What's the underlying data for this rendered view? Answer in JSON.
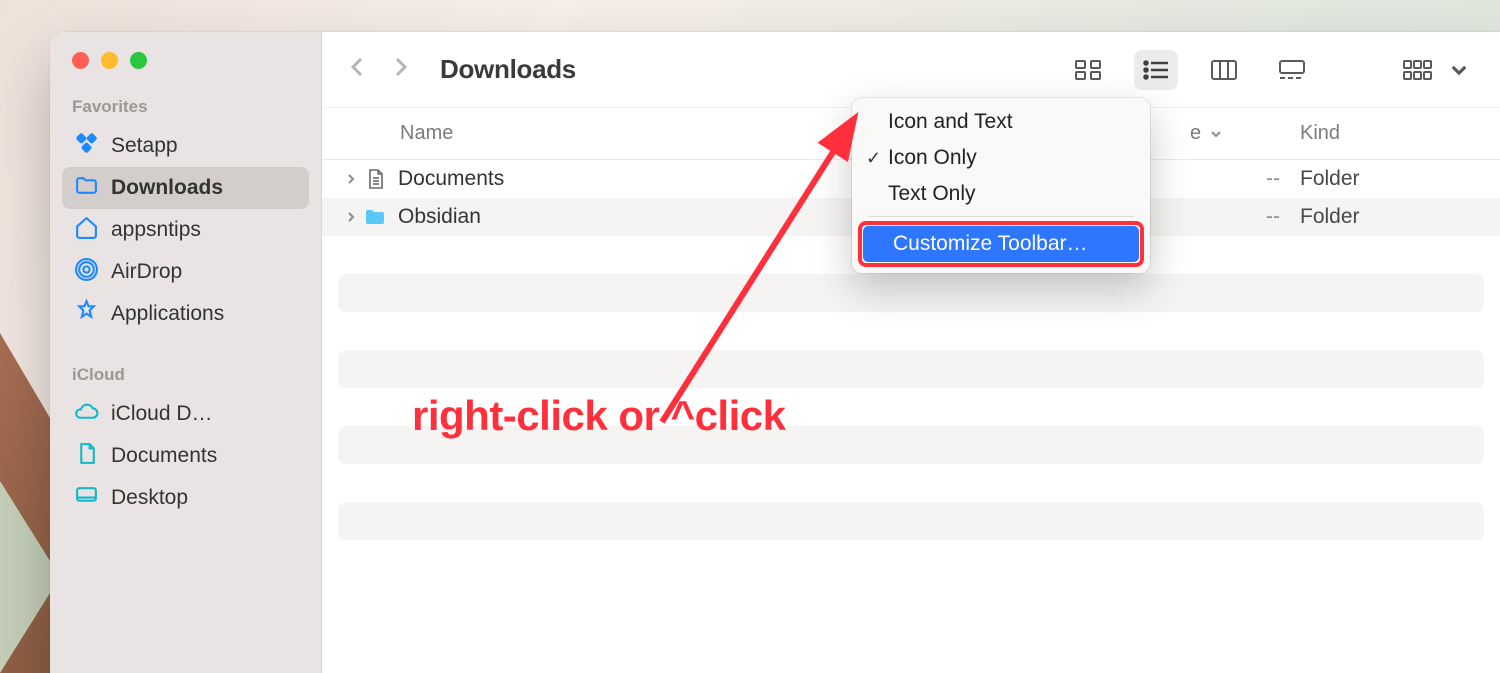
{
  "toolbar": {
    "title": "Downloads"
  },
  "sidebar": {
    "favorites_label": "Favorites",
    "icloud_label": "iCloud",
    "favorites": [
      {
        "label": "Setapp"
      },
      {
        "label": "Downloads"
      },
      {
        "label": "appsntips"
      },
      {
        "label": "AirDrop"
      },
      {
        "label": "Applications"
      }
    ],
    "icloud": [
      {
        "label": "iCloud D…"
      },
      {
        "label": "Documents"
      },
      {
        "label": "Desktop"
      }
    ]
  },
  "columns": {
    "name": "Name",
    "size_suffix": "e",
    "kind": "Kind"
  },
  "rows": [
    {
      "name": "Documents",
      "size": "--",
      "kind": "Folder",
      "icon": "doc"
    },
    {
      "name": "Obsidian",
      "size": "--",
      "kind": "Folder",
      "icon": "folder"
    }
  ],
  "context_menu": {
    "items": [
      {
        "label": "Icon and Text"
      },
      {
        "label": "Icon Only"
      },
      {
        "label": "Text Only"
      }
    ],
    "customize": "Customize Toolbar…"
  },
  "annotation": "right-click or ^click"
}
